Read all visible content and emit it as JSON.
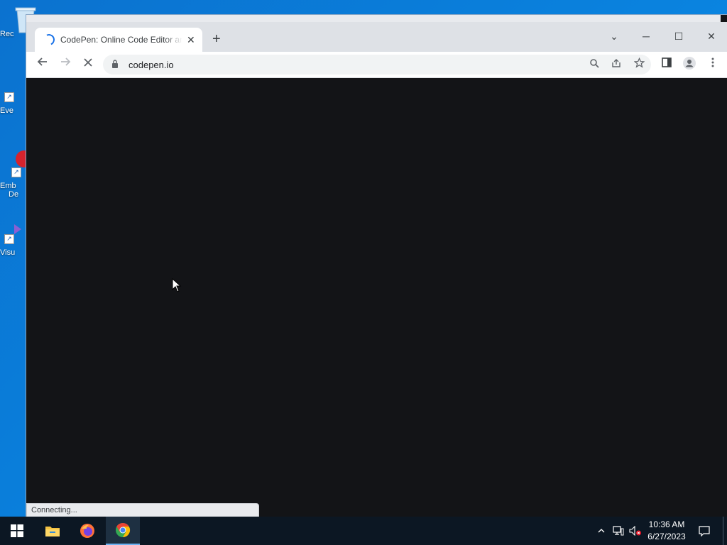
{
  "desktop": {
    "icons": [
      {
        "label": "Rec"
      },
      {
        "label": "Eve"
      },
      {
        "label": "Emb"
      },
      {
        "label": "De"
      },
      {
        "label": "Visu"
      }
    ]
  },
  "browser": {
    "tab": {
      "title": "CodePen: Online Code Editor and"
    },
    "url": "codepen.io",
    "status": "Connecting...",
    "window_controls": {
      "dropdown": "⌄",
      "minimize": "─",
      "maximize": "☐",
      "close": "✕"
    }
  },
  "taskbar": {
    "time": "10:36 AM",
    "date": "6/27/2023",
    "apps": [
      "start",
      "file-explorer",
      "firefox",
      "chrome"
    ]
  },
  "colors": {
    "desktop_bg": "#0a78d7",
    "page_bg": "#131417",
    "chrome_frame": "#dee1e6",
    "taskbar": "#0c1723"
  }
}
